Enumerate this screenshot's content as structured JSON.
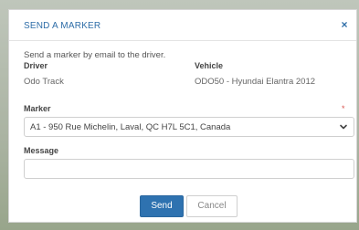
{
  "modal": {
    "title": "SEND A MARKER",
    "close_glyph": "×",
    "intro": "Send a marker by email to the driver.",
    "driver_label": "Driver",
    "driver_value": "Odo Track",
    "vehicle_label": "Vehicle",
    "vehicle_value": "ODO50 - Hyundai Elantra 2012",
    "marker_label": "Marker",
    "marker_required": "*",
    "marker_selected": "A1 - 950 Rue Michelin, Laval, QC H7L 5C1, Canada",
    "message_label": "Message",
    "message_value": "",
    "send_label": "Send",
    "cancel_label": "Cancel"
  },
  "colors": {
    "accent": "#2e72b0",
    "title": "#2f6ea8",
    "required": "#d9534f"
  },
  "icons": {
    "close": "close-icon",
    "dropdown": "chevron-down-icon"
  }
}
